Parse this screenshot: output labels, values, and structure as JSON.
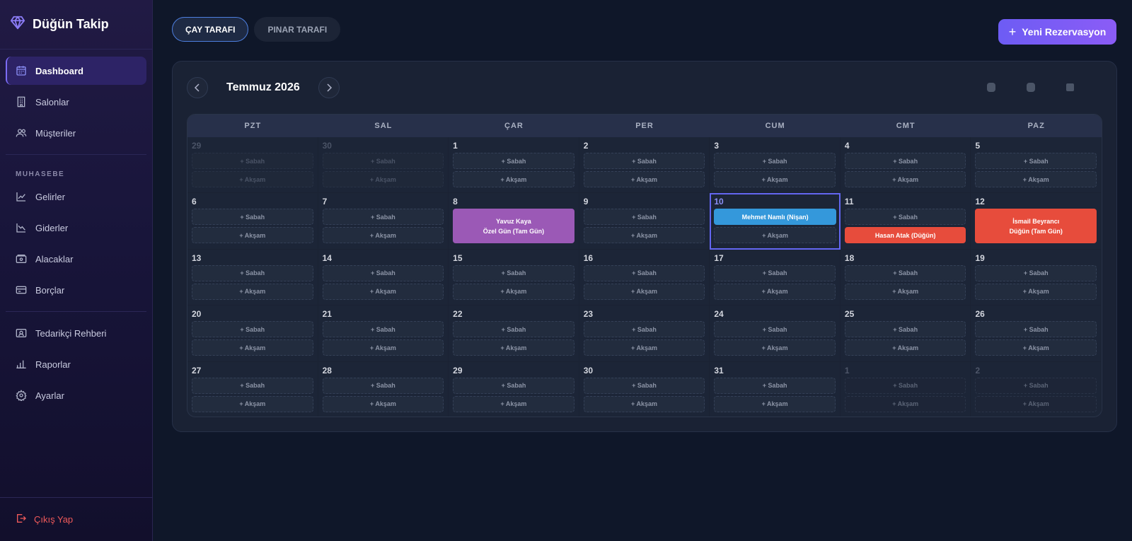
{
  "app": {
    "title": "Düğün Takip"
  },
  "sidebar": {
    "items": [
      {
        "label": "Dashboard",
        "icon": "calendar-icon",
        "active": true
      },
      {
        "label": "Salonlar",
        "icon": "building-icon"
      },
      {
        "label": "Müşteriler",
        "icon": "users-icon"
      }
    ],
    "section_label": "MUHASEBE",
    "accounting_items": [
      {
        "label": "Gelirler",
        "icon": "trend-up-icon"
      },
      {
        "label": "Giderler",
        "icon": "trend-down-icon"
      },
      {
        "label": "Alacaklar",
        "icon": "wallet-icon"
      },
      {
        "label": "Borçlar",
        "icon": "credit-card-icon"
      }
    ],
    "other_items": [
      {
        "label": "Tedarikçi Rehberi",
        "icon": "contact-card-icon"
      },
      {
        "label": "Raporlar",
        "icon": "bar-chart-icon"
      },
      {
        "label": "Ayarlar",
        "icon": "gear-icon"
      }
    ],
    "logout_label": "Çıkış Yap"
  },
  "tabs": [
    {
      "label": "ÇAY TARAFI",
      "active": true
    },
    {
      "label": "PINAR TARAFI",
      "active": false
    }
  ],
  "new_reservation": {
    "label": "Yeni Rezervasyon",
    "icon": "plus-icon"
  },
  "calendar": {
    "month_label": "Temmuz 2026",
    "weekdays": [
      "PZT",
      "SAL",
      "ÇAR",
      "PER",
      "CUM",
      "CMT",
      "PAZ"
    ],
    "slot_morning": "+ Sabah",
    "slot_evening": "+ Akşam",
    "weeks": [
      [
        {
          "day": "29",
          "muted": true
        },
        {
          "day": "30",
          "muted": true
        },
        {
          "day": "1"
        },
        {
          "day": "2"
        },
        {
          "day": "3"
        },
        {
          "day": "4"
        },
        {
          "day": "5"
        }
      ],
      [
        {
          "day": "6"
        },
        {
          "day": "7"
        },
        {
          "day": "8",
          "full_event": {
            "line1": "Yavuz Kaya",
            "line2": "Özel Gün (Tam Gün)",
            "color": "#9b59b6"
          }
        },
        {
          "day": "9"
        },
        {
          "day": "10",
          "today": true,
          "morning_event": {
            "label": "Mehmet Namlı (Nişan)",
            "color": "#3498db"
          }
        },
        {
          "day": "11",
          "evening_event": {
            "label": "Hasan Atak (Düğün)",
            "color": "#e74c3c"
          }
        },
        {
          "day": "12",
          "full_event": {
            "line1": "İsmail Beyrancı",
            "line2": "Düğün (Tam Gün)",
            "color": "#e74c3c"
          }
        }
      ],
      [
        {
          "day": "13"
        },
        {
          "day": "14"
        },
        {
          "day": "15"
        },
        {
          "day": "16"
        },
        {
          "day": "17"
        },
        {
          "day": "18"
        },
        {
          "day": "19"
        }
      ],
      [
        {
          "day": "20"
        },
        {
          "day": "21"
        },
        {
          "day": "22"
        },
        {
          "day": "23"
        },
        {
          "day": "24"
        },
        {
          "day": "25"
        },
        {
          "day": "26"
        }
      ],
      [
        {
          "day": "27"
        },
        {
          "day": "28"
        },
        {
          "day": "29"
        },
        {
          "day": "30"
        },
        {
          "day": "31"
        },
        {
          "day": "1",
          "muted": true,
          "dim": true
        },
        {
          "day": "2",
          "muted": true,
          "dim": true
        }
      ]
    ]
  },
  "colors": {
    "accent": "#6d5cf4",
    "danger": "#ef5a5a",
    "event_purple": "#9b59b6",
    "event_blue": "#3498db",
    "event_red": "#e74c3c"
  }
}
